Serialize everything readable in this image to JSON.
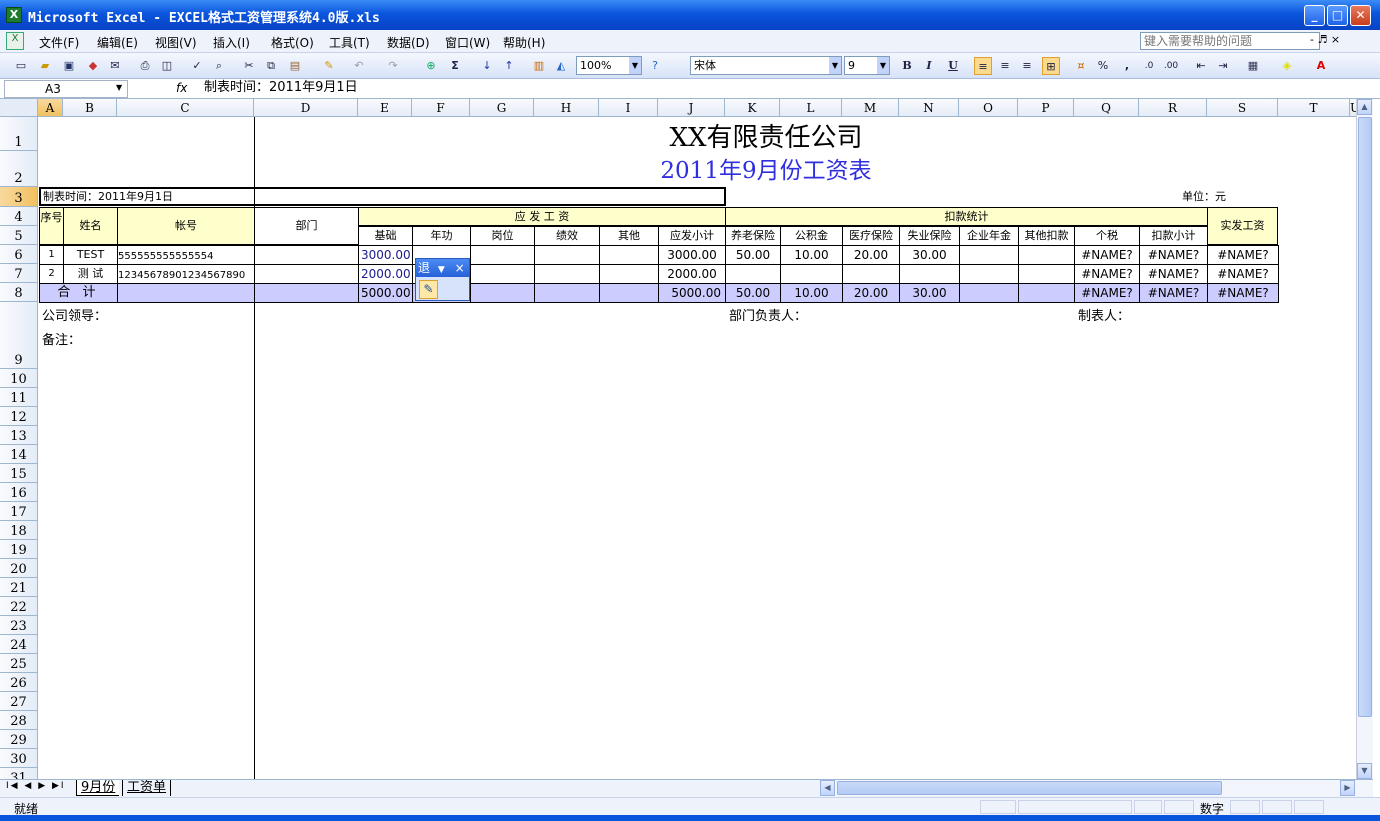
{
  "window": {
    "title": "Microsoft Excel - EXCEL格式工资管理系统4.0版.xls",
    "min": "_",
    "max": "□",
    "close": "✕"
  },
  "menu": {
    "items": [
      "文件(F)",
      "编辑(E)",
      "视图(V)",
      "插入(I)",
      "格式(O)",
      "工具(T)",
      "数据(D)",
      "窗口(W)",
      "帮助(H)"
    ],
    "help_placeholder": "键入需要帮助的问题",
    "doc_controls": "- ♬ ×"
  },
  "toolbar": {
    "zoom": "100%",
    "font": "宋体",
    "size": "9",
    "bold": "B",
    "italic": "I",
    "underline": "U",
    "percent": "%",
    "comma": ","
  },
  "formula_bar": {
    "cell_ref": "A3",
    "fx": "fx",
    "content": "制表时间：2011年9月1日"
  },
  "columns": [
    "A",
    "B",
    "C",
    "D",
    "E",
    "F",
    "G",
    "H",
    "I",
    "J",
    "K",
    "L",
    "M",
    "N",
    "O",
    "P",
    "Q",
    "R",
    "S",
    "T",
    "U"
  ],
  "rows": [
    "1",
    "2",
    "3",
    "4",
    "5",
    "6",
    "7",
    "8",
    "9",
    "10",
    "11",
    "12",
    "13",
    "14",
    "15",
    "16",
    "17",
    "18",
    "19",
    "20",
    "21",
    "22",
    "23",
    "24",
    "25",
    "26",
    "27",
    "28",
    "29",
    "30",
    "31"
  ],
  "sheet": {
    "company": "XX有限责任公司",
    "subtitle": "2011年9月份工资表",
    "date_label": "制表时间：2011年9月1日",
    "unit": "单位：元",
    "h_seq": "序号",
    "h_name": "姓名",
    "h_account": "帐号",
    "h_dept": "部门",
    "h_payable": "应 发 工 资",
    "h_deduct": "扣款统计",
    "h_actual": "实发工资",
    "sub": [
      "基础",
      "年功",
      "岗位",
      "绩效",
      "其他",
      "应发小计",
      "养老保险",
      "公积金",
      "医疗保险",
      "失业保险",
      "企业年金",
      "其他扣款",
      "个税",
      "扣款小计"
    ],
    "r1": {
      "seq": "1",
      "name": "TEST",
      "account": "555555555555554",
      "base": "3000.00",
      "subtotal": "3000.00",
      "pension": "50.00",
      "fund": "10.00",
      "medical": "20.00",
      "unemp": "30.00",
      "tax": "#NAME?",
      "dsub": "#NAME?",
      "actual": "#NAME?"
    },
    "r2": {
      "seq": "2",
      "name": "测 试",
      "account": "12345678901234567890",
      "base": "2000.00",
      "subtotal": "2000.00",
      "tax": "#NAME?",
      "dsub": "#NAME?",
      "actual": "#NAME?"
    },
    "total": {
      "label": "合 计",
      "base": "5000.00",
      "subtotal": "5000.00",
      "pension": "50.00",
      "fund": "10.00",
      "medical": "20.00",
      "unemp": "30.00",
      "tax": "#NAME?",
      "dsub": "#NAME?",
      "actual": "#NAME?"
    },
    "leader": "公司领导：",
    "dept_head": "部门负责人：",
    "maker": "制表人：",
    "remark": "备注："
  },
  "float_toolbar": {
    "title": "退",
    "arrow": "▼",
    "close": "×"
  },
  "tabs": {
    "nav": "I◀ ◀ ▶ ▶I",
    "sheet1": "9月份",
    "sheet2": "工资单"
  },
  "status": {
    "ready": "就绪",
    "mode": "数字"
  }
}
